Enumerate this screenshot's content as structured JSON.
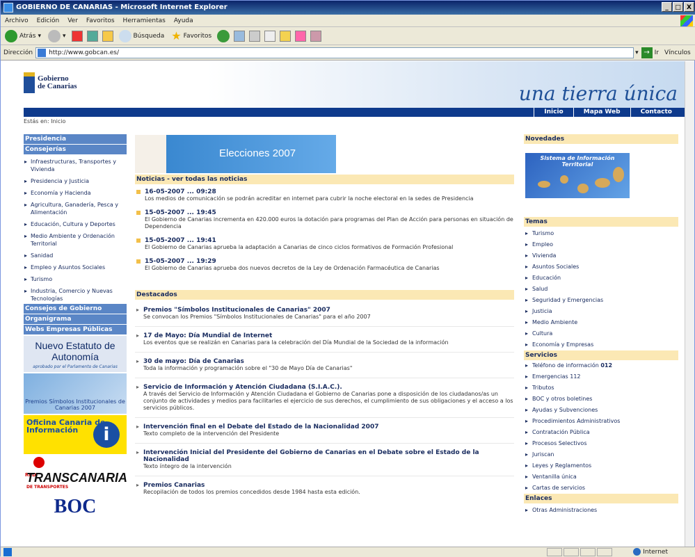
{
  "window": {
    "title": "GOBIERNO DE CANARIAS - Microsoft Internet Explorer",
    "controls": [
      "_",
      "□",
      "X"
    ]
  },
  "menu": [
    "Archivo",
    "Edición",
    "Ver",
    "Favoritos",
    "Herramientas",
    "Ayuda"
  ],
  "toolbar": {
    "back": "Atrás",
    "search": "Búsqueda",
    "favorites": "Favoritos"
  },
  "address": {
    "label": "Dirección",
    "url": "http://www.gobcan.es/",
    "go": "Ir",
    "links": "Vínculos"
  },
  "status": {
    "zone": "Internet"
  },
  "header": {
    "logo_line1": "Gobierno",
    "logo_line2": "de Canarias",
    "tagline": "una tierra única",
    "nav": [
      "Inicio",
      "Mapa Web",
      "Contacto"
    ],
    "breadcrumb": "Estás en: Inicio"
  },
  "left": {
    "sec1": "Presidencia",
    "sec2": "Consejerías",
    "items": [
      "Infraestructuras, Transportes y Vivienda",
      "Presidencia y Justicia",
      "Economía y Hacienda",
      "Agricultura, Ganadería, Pesca y Alimentación",
      "Educación, Cultura y Deportes",
      "Medio Ambiente y Ordenación Territorial",
      "Sanidad",
      "Empleo y Asuntos Sociales",
      "Turismo",
      "Industria, Comercio y Nuevas Tecnologías"
    ],
    "sec3": "Consejos de Gobierno",
    "sec4": "Organigrama",
    "sec5": "Webs Empresas Públicas",
    "banner_estatuto": "Nuevo Estatuto de Autonomía",
    "banner_estatuto_sub": "aprobado por el Parlamento de Canarias",
    "banner_premios": "Premios Símbolos Institucionales de Canarias 2007",
    "banner_oficina": "Oficina Canaria de Información",
    "banner_transcanaria": "TRANSCANARIA",
    "banner_transcanaria_sub": "DE TRANSPORTES",
    "banner_transcanaria_red": "RED",
    "banner_boc": "BOC"
  },
  "main": {
    "banner_elecciones": "Elecciones 2007",
    "news_header": "Noticias - ver todas las noticias",
    "news": [
      {
        "date": "16-05-2007 ... 09:28",
        "text": "Los medios de comunicación se podrán acreditar en internet para cubrir la noche electoral en la sedes de Presidencia"
      },
      {
        "date": "15-05-2007 ... 19:45",
        "text": "El Gobierno de Canarias incrementa en 420.000 euros la dotación para programas del Plan de Acción para personas en situación de Dependencia"
      },
      {
        "date": "15-05-2007 ... 19:41",
        "text": "El Gobierno de Canarias aprueba la adaptación a Canarias de cinco ciclos formativos de Formación Profesional"
      },
      {
        "date": "15-05-2007 ... 19:29",
        "text": "El Gobierno de Canarias aprueba dos nuevos decretos de la Ley de Ordenación Farmacéutica de Canarias"
      }
    ],
    "dest_header": "Destacados",
    "destacados": [
      {
        "title": "Premios \"Símbolos Institucionales de Canarias\" 2007",
        "text": "Se convocan los Premios \"Símbolos Institucionales de Canarias\" para el año 2007"
      },
      {
        "title": "17 de Mayo: Día Mundial de Internet",
        "text": "Los eventos que se realizán en Canarias para la celebración del Día Mundial de la Sociedad de la información"
      },
      {
        "title": "30 de mayo: Día de Canarias",
        "text": "Toda la información y programación sobre el \"30 de Mayo Día de Canarias\""
      },
      {
        "title": "Servicio de Información y Atención Ciudadana (S.I.A.C.).",
        "text": "A través del Servicio de Información y Atención Ciudadana el Gobierno de Canarias pone a disposición de los ciudadanos/as un conjunto de actividades y medios para facilitarles el ejercicio de sus derechos, el cumplimiento de sus obligaciones y el acceso a los servicios públicos."
      },
      {
        "title": "Intervención final en el Debate del Estado de la Nacionalidad 2007",
        "text": "Texto completo de la intervención del Presidente"
      },
      {
        "title": "Intervención Inicial del Presidente del Gobierno de Canarias en el Debate sobre el Estado de la Nacionalidad",
        "text": "Texto íntegro de la intervención"
      },
      {
        "title": "Premios Canarias",
        "text": "Recopilación de todos los premios concedidos desde 1984 hasta esta edición."
      }
    ]
  },
  "right": {
    "novedades": "Novedades",
    "sit_title": "Sistema de Información Territorial",
    "temas": "Temas",
    "temas_items": [
      "Turismo",
      "Empleo",
      "Vivienda",
      "Asuntos Sociales",
      "Educación",
      "Salud",
      "Seguridad y Emergencias",
      "Justicia",
      "Medio Ambiente",
      "Cultura",
      "Economía y Empresas"
    ],
    "servicios": "Servicios",
    "tel_label": "Teléfono de información",
    "tel_num": "012",
    "servicios_items": [
      "Emergencias 112",
      "Tributos",
      "BOC y otros boletines",
      "Ayudas y Subvenciones",
      "Procedimientos Administrativos",
      "Contratación Pública",
      "Procesos Selectivos",
      "Juriscan",
      "Leyes y Reglamentos",
      "Ventanilla única",
      "Cartas de servicios"
    ],
    "enlaces": "Enlaces",
    "enlaces_items": [
      "Otras Administraciones"
    ]
  }
}
